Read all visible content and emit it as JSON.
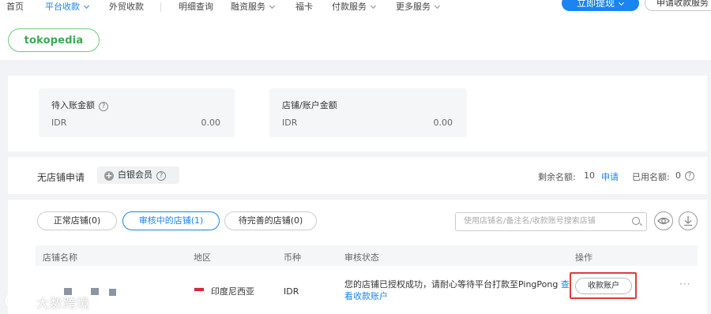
{
  "nav": {
    "items": [
      {
        "label": "首页",
        "active": false,
        "caret": false
      },
      {
        "label": "平台收款",
        "active": true,
        "caret": true
      },
      {
        "label": "外贸收款",
        "active": false,
        "caret": false
      },
      {
        "label": "明细查询",
        "active": false,
        "caret": false
      },
      {
        "label": "融资服务",
        "active": false,
        "caret": true
      },
      {
        "label": "福卡",
        "active": false,
        "caret": false
      },
      {
        "label": "付款服务",
        "active": false,
        "caret": true
      },
      {
        "label": "更多服务",
        "active": false,
        "caret": true
      }
    ],
    "withdraw_button": "立即提现",
    "apply_button": "申请收款服务"
  },
  "platform": {
    "logo_text": "tokopedia",
    "brand_color": "#3aa954"
  },
  "balances": [
    {
      "title": "待入账金额",
      "currency": "IDR",
      "amount": "0.00",
      "has_help": true
    },
    {
      "title": "店铺/账户金额",
      "currency": "IDR",
      "amount": "0.00",
      "has_help": false
    }
  ],
  "membership": {
    "label": "无店铺申请",
    "badge": "白银会员",
    "remaining_label": "剩余名额:",
    "remaining_value": "10",
    "apply_link": "申请",
    "used_label": "已用名额:",
    "used_value": "0"
  },
  "tabs": [
    {
      "label": "正常店铺(0)",
      "active": false
    },
    {
      "label": "审核中的店铺(1)",
      "active": true
    },
    {
      "label": "待完善的店铺(0)",
      "active": false
    }
  ],
  "search": {
    "placeholder": "使用店铺名/备注名/收款账号搜索店铺"
  },
  "table": {
    "headers": [
      "店铺名称",
      "地区",
      "币种",
      "审核状态",
      "操作"
    ],
    "rows": [
      {
        "region": "印度尼西亚",
        "currency": "IDR",
        "status_text": "您的店铺已授权成功，请耐心等待平台打款至PingPong",
        "status_link_1": "查",
        "status_link_2": "看收款账户",
        "action": "收款账户",
        "more": "···"
      }
    ]
  },
  "watermark": {
    "text": "大数跨境"
  },
  "colors": {
    "accent": "#1a84f0",
    "highlight": "#e23a3a"
  }
}
